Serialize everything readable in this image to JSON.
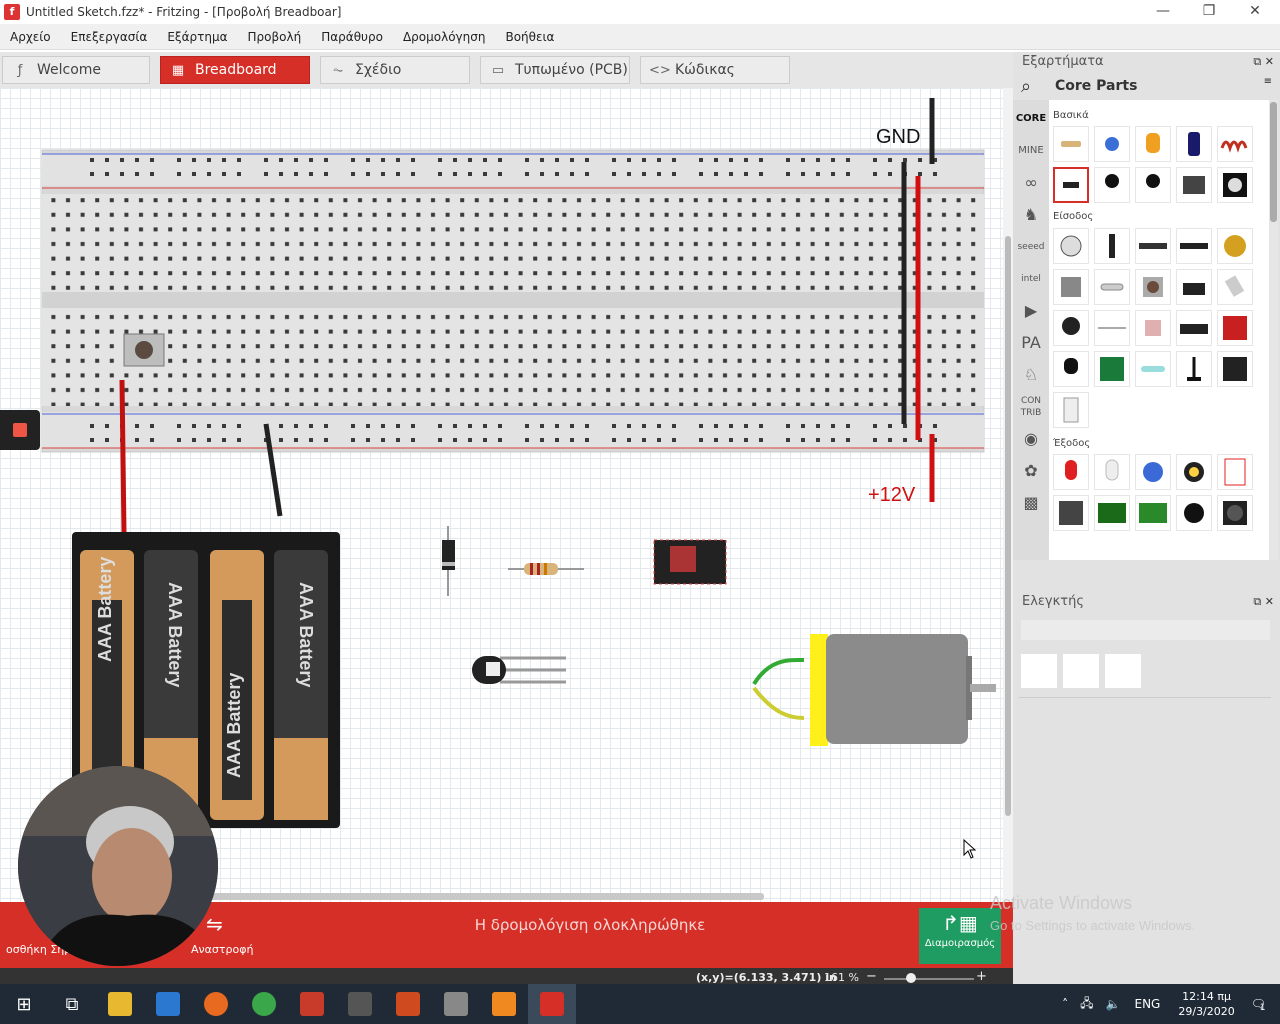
{
  "window": {
    "title": "Untitled Sketch.fzz* - Fritzing - [Προβολή Breadboar]",
    "app_icon": "f",
    "minimize": "—",
    "maximize": "❐",
    "close": "✕"
  },
  "menu": [
    "Αρχείο",
    "Επεξεργασία",
    "Εξάρτημα",
    "Προβολή",
    "Παράθυρο",
    "Δρομολόγηση",
    "Βοήθεια"
  ],
  "tabs": [
    {
      "label": "Welcome",
      "icon": "fritzing-icon"
    },
    {
      "label": "Breadboard",
      "icon": "breadboard-icon",
      "active": true
    },
    {
      "label": "Σχέδιο",
      "icon": "schematic-icon"
    },
    {
      "label": "Τυπωμένο (PCB)",
      "icon": "pcb-icon"
    },
    {
      "label": "Κώδικας",
      "icon": "code-icon"
    }
  ],
  "canvas": {
    "gnd_label": "GND",
    "v12_label": "+12V",
    "battery_label": "AAA Battery"
  },
  "status": {
    "message": "Η δρομολόγιση ολοκληρώθηκε",
    "add_note_label": "οσθήκη Σημ",
    "rotate_label": "Αναστροφή",
    "share_label": "Διαμοιρασμός",
    "coords": "(x,y)=(6.133, 3.471) in",
    "zoom": "161 %",
    "zoom_out": "−",
    "zoom_in": "+",
    "zoom_level": 0.3
  },
  "watermark": {
    "line1": "Activate Windows",
    "line2": "Go to Settings to activate Windows."
  },
  "parts_panel": {
    "title": "Εξαρτήματα",
    "bin_title": "Core Parts",
    "bins": [
      "CORE",
      "MINE",
      "arduino-icon",
      "snootlab-icon",
      "seeed",
      "intel",
      "video-icon",
      "PA",
      "animal-icon",
      "CON TRIB",
      "misc-icon",
      "flower-icon",
      "chip-icon"
    ],
    "categories": {
      "basic": "Βασικά",
      "input": "Είσοδος",
      "output": "Έξοδος"
    }
  },
  "inspector": {
    "title": "Ελεγκτής"
  },
  "taskbar": {
    "lang": "ENG",
    "time": "12:14 πμ",
    "date": "29/3/2020",
    "notifications": "1"
  },
  "colors": {
    "accent": "#d62f27",
    "share": "#1e9c62",
    "taskbar": "#202a36"
  }
}
